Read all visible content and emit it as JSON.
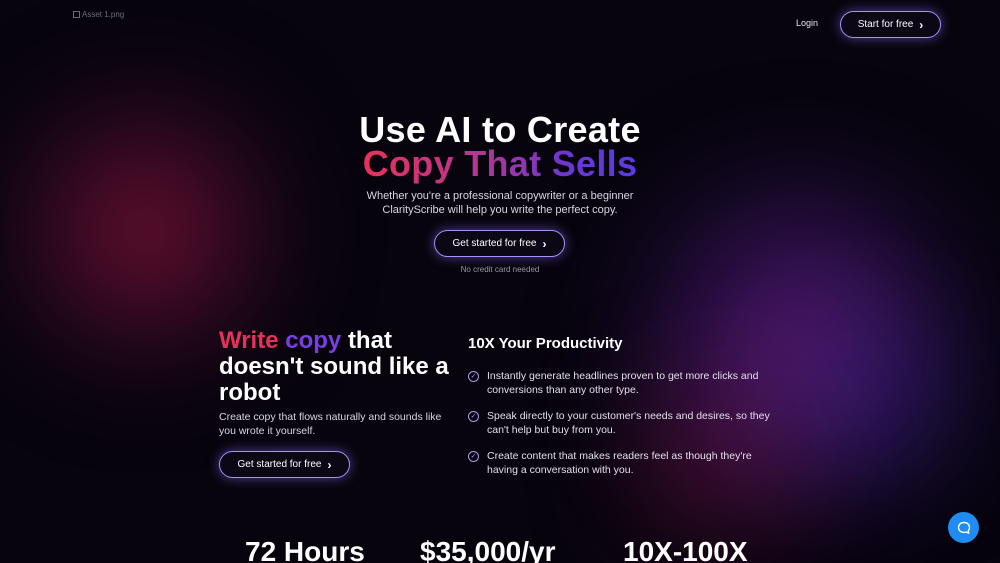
{
  "logo": {
    "alt": "Asset 1.png"
  },
  "nav": {
    "login": "Login",
    "cta": "Start for free"
  },
  "hero": {
    "title_line1": "Use AI to Create",
    "title_line2": "Copy That Sells",
    "subtitle_line1": "Whether you're a professional copywriter or a beginner",
    "subtitle_line2": "ClarityScribe will help you write the perfect copy.",
    "cta": "Get started for free",
    "note": "No credit card needed"
  },
  "feature": {
    "title_word1": "Write",
    "title_word2": "copy",
    "title_rest": "that doesn't sound like a robot",
    "description": "Create copy that flows naturally and sounds like you wrote it yourself.",
    "cta": "Get started for free"
  },
  "productivity": {
    "title": "10X Your Productivity",
    "items": [
      "Instantly generate headlines proven to get more clicks and conversions than any other type.",
      "Speak directly to your customer's needs and desires, so they can't help but buy from you.",
      "Create content that makes readers feel as though they're having a conversation with you."
    ]
  },
  "stats": [
    "72 Hours",
    "$35,000/yr",
    "10X-100X"
  ],
  "colors": {
    "background": "#07040d",
    "accent_border": "#a892ff",
    "gradient_start": "#e8315a",
    "gradient_end": "#5a3be0",
    "chat_button": "#1e8cf0"
  },
  "icons": {
    "chevron": "chevron-right-icon",
    "check": "check-circle-icon",
    "chat": "chat-bubble-icon"
  }
}
